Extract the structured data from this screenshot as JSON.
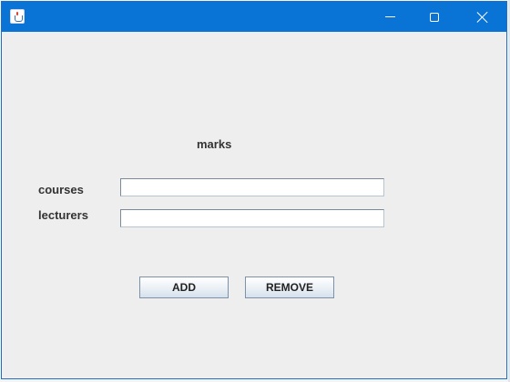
{
  "window": {
    "title": "",
    "icon": "java-cup-icon",
    "controls": [
      "minimize",
      "maximize",
      "close"
    ]
  },
  "form": {
    "heading": "marks",
    "fields": [
      {
        "label": "courses",
        "value": "",
        "placeholder": ""
      },
      {
        "label": "lecturers",
        "value": "",
        "placeholder": ""
      }
    ],
    "buttons": {
      "add": "ADD",
      "remove": "REMOVE"
    }
  },
  "colors": {
    "titlebar": "#0a73d6",
    "window_bg": "#eeeeee",
    "label_text": "#333333"
  }
}
